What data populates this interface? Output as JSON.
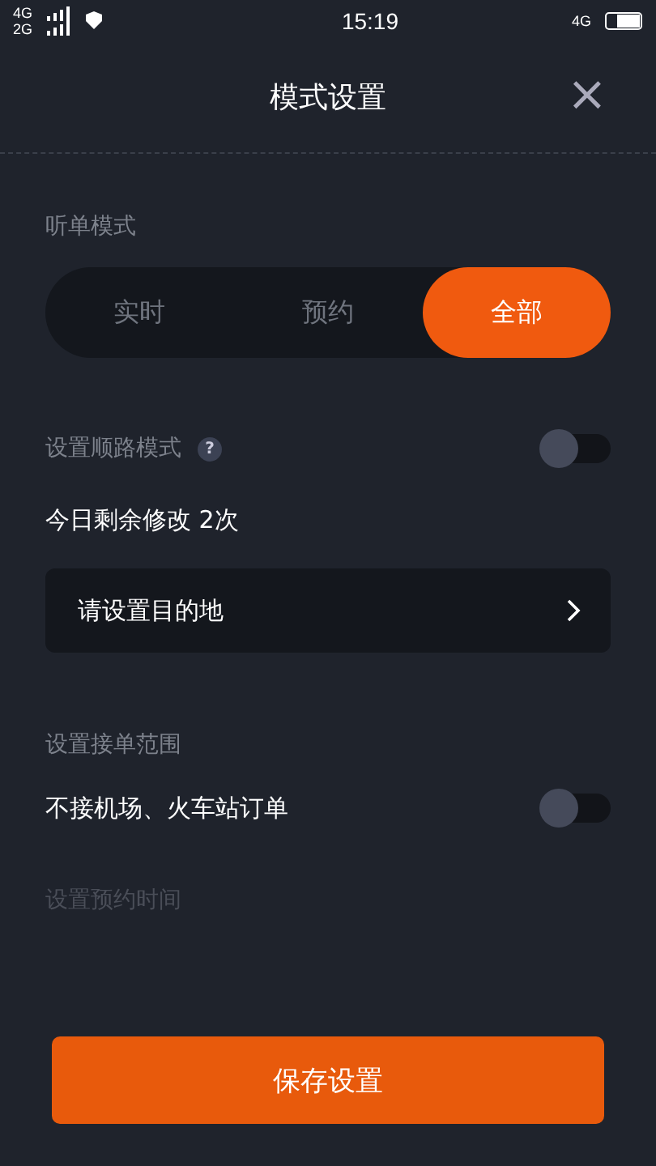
{
  "status_bar": {
    "network_1": "4G",
    "network_2": "2G",
    "time": "15:19",
    "network_right": "4G"
  },
  "header": {
    "title": "模式设置",
    "close": "×"
  },
  "order_mode": {
    "label": "听单模式",
    "options": [
      {
        "label": "实时",
        "selected": false
      },
      {
        "label": "预约",
        "selected": false
      },
      {
        "label": "全部",
        "selected": true
      }
    ]
  },
  "route_mode": {
    "label": "设置顺路模式",
    "help": "?",
    "on": false,
    "remaining": "今日剩余修改 2次",
    "destination": {
      "placeholder": "请设置目的地"
    }
  },
  "range": {
    "label": "设置接单范围",
    "items": [
      {
        "label": "不接机场、火车站订单",
        "on": false
      }
    ]
  },
  "reservation_time": {
    "label": "设置预约时间"
  },
  "save_button": "保存设置"
}
